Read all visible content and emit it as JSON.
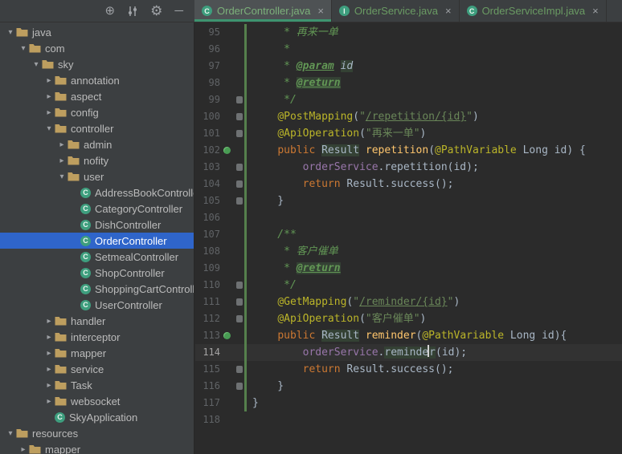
{
  "toolbar": {
    "icons": [
      {
        "name": "locate-icon",
        "glyph": "⊕"
      },
      {
        "name": "filter-sliders-icon",
        "glyph": "sliders"
      },
      {
        "name": "settings-gear-icon",
        "glyph": "⚙"
      },
      {
        "name": "hide-panel-icon",
        "glyph": "─"
      }
    ]
  },
  "tabs": [
    {
      "label": "OrderController.java",
      "icon_letter": "C",
      "close": "×",
      "active": true
    },
    {
      "label": "OrderService.java",
      "icon_letter": "I",
      "close": "×",
      "active": false
    },
    {
      "label": "OrderServiceImpl.java",
      "icon_letter": "C",
      "close": "×",
      "active": false
    }
  ],
  "colors": {
    "panel_bg": "#3C3F41",
    "editor_bg": "#2B2B2B",
    "selection_blue": "#2F65CA",
    "vcs_added_green": "#55804C",
    "tab_added_file_text": "#6A9B63",
    "active_tab_underline": "#3E946F",
    "identifier_highlight": "#344134",
    "folder": "#BD9E5F",
    "class_icon": "#3E9E7E"
  },
  "project_tree": {
    "items": [
      {
        "label": "java",
        "level": 0,
        "kind": "folder",
        "state": "open",
        "selected": false
      },
      {
        "label": "com",
        "level": 1,
        "kind": "folder",
        "state": "open",
        "selected": false
      },
      {
        "label": "sky",
        "level": 2,
        "kind": "folder",
        "state": "open",
        "selected": false
      },
      {
        "label": "annotation",
        "level": 3,
        "kind": "folder",
        "state": "closed",
        "selected": false
      },
      {
        "label": "aspect",
        "level": 3,
        "kind": "folder",
        "state": "closed",
        "selected": false
      },
      {
        "label": "config",
        "level": 3,
        "kind": "folder",
        "state": "closed",
        "selected": false
      },
      {
        "label": "controller",
        "level": 3,
        "kind": "folder",
        "state": "open",
        "selected": false
      },
      {
        "label": "admin",
        "level": 4,
        "kind": "folder",
        "state": "closed",
        "selected": false
      },
      {
        "label": "nofity",
        "level": 4,
        "kind": "folder",
        "state": "closed",
        "selected": false
      },
      {
        "label": "user",
        "level": 4,
        "kind": "folder",
        "state": "open",
        "selected": false
      },
      {
        "label": "AddressBookController",
        "level": 5,
        "kind": "class",
        "state": "leaf",
        "selected": false
      },
      {
        "label": "CategoryController",
        "level": 5,
        "kind": "class",
        "state": "leaf",
        "selected": false
      },
      {
        "label": "DishController",
        "level": 5,
        "kind": "class",
        "state": "leaf",
        "selected": false
      },
      {
        "label": "OrderController",
        "level": 5,
        "kind": "class",
        "state": "leaf",
        "selected": true
      },
      {
        "label": "SetmealController",
        "level": 5,
        "kind": "class",
        "state": "leaf",
        "selected": false
      },
      {
        "label": "ShopController",
        "level": 5,
        "kind": "class",
        "state": "leaf",
        "selected": false
      },
      {
        "label": "ShoppingCartController",
        "level": 5,
        "kind": "class",
        "state": "leaf",
        "selected": false
      },
      {
        "label": "UserController",
        "level": 5,
        "kind": "class",
        "state": "leaf",
        "selected": false
      },
      {
        "label": "handler",
        "level": 3,
        "kind": "folder",
        "state": "closed",
        "selected": false
      },
      {
        "label": "interceptor",
        "level": 3,
        "kind": "folder",
        "state": "closed",
        "selected": false
      },
      {
        "label": "mapper",
        "level": 3,
        "kind": "folder",
        "state": "closed",
        "selected": false
      },
      {
        "label": "service",
        "level": 3,
        "kind": "folder",
        "state": "closed",
        "selected": false
      },
      {
        "label": "Task",
        "level": 3,
        "kind": "folder",
        "state": "closed",
        "selected": false
      },
      {
        "label": "websocket",
        "level": 3,
        "kind": "folder",
        "state": "closed",
        "selected": false
      },
      {
        "label": "SkyApplication",
        "level": 3,
        "kind": "class",
        "state": "leaf",
        "selected": false
      },
      {
        "label": "resources",
        "level": 0,
        "kind": "folder",
        "state": "open",
        "selected": false
      },
      {
        "label": "mapper",
        "level": 1,
        "kind": "folder",
        "state": "closed",
        "selected": false
      }
    ]
  },
  "editor": {
    "current_line": 114,
    "lines": [
      {
        "n": 95,
        "mark": null,
        "seg": [
          [
            "c",
            "     * 再来一单"
          ]
        ]
      },
      {
        "n": 96,
        "mark": null,
        "seg": [
          [
            "c",
            "     *"
          ]
        ]
      },
      {
        "n": 97,
        "mark": null,
        "seg": [
          [
            "c",
            "     * "
          ],
          [
            "ct",
            "@param"
          ],
          [
            "c",
            " "
          ],
          [
            "cb",
            "id"
          ]
        ]
      },
      {
        "n": 98,
        "mark": null,
        "seg": [
          [
            "c",
            "     * "
          ],
          [
            "ctb",
            "@return"
          ]
        ]
      },
      {
        "n": 99,
        "mark": "gray",
        "seg": [
          [
            "c",
            "     */"
          ]
        ]
      },
      {
        "n": 100,
        "mark": "gray",
        "seg": [
          [
            "d",
            "    "
          ],
          [
            "a",
            "@PostMapping"
          ],
          [
            "d",
            "("
          ],
          [
            "s",
            "\""
          ],
          [
            "su",
            "/repetition/{id}"
          ],
          [
            "s",
            "\""
          ],
          [
            "d",
            ")"
          ]
        ]
      },
      {
        "n": 101,
        "mark": "gray",
        "seg": [
          [
            "d",
            "    "
          ],
          [
            "a",
            "@ApiOperation"
          ],
          [
            "d",
            "("
          ],
          [
            "s",
            "\"再来一单\""
          ],
          [
            "d",
            ")"
          ]
        ]
      },
      {
        "n": 102,
        "mark": "green",
        "seg": [
          [
            "d",
            "    "
          ],
          [
            "k",
            "public"
          ],
          [
            "d",
            " "
          ],
          [
            "box",
            "Result"
          ],
          [
            "d",
            " "
          ],
          [
            "m",
            "repetition"
          ],
          [
            "d",
            "("
          ],
          [
            "a",
            "@PathVariable"
          ],
          [
            "d",
            " Long id) {"
          ]
        ]
      },
      {
        "n": 103,
        "mark": "gray",
        "seg": [
          [
            "d",
            "        "
          ],
          [
            "f",
            "orderService"
          ],
          [
            "d",
            ".repetition(id);"
          ]
        ]
      },
      {
        "n": 104,
        "mark": "gray",
        "seg": [
          [
            "d",
            "        "
          ],
          [
            "k",
            "return"
          ],
          [
            "d",
            " Result.success();"
          ]
        ]
      },
      {
        "n": 105,
        "mark": "gray",
        "seg": [
          [
            "d",
            "    }"
          ]
        ]
      },
      {
        "n": 106,
        "mark": null,
        "seg": []
      },
      {
        "n": 107,
        "mark": null,
        "seg": [
          [
            "c",
            "    /**"
          ]
        ]
      },
      {
        "n": 108,
        "mark": null,
        "seg": [
          [
            "c",
            "     * 客户催单"
          ]
        ]
      },
      {
        "n": 109,
        "mark": null,
        "seg": [
          [
            "c",
            "     * "
          ],
          [
            "ctb",
            "@return"
          ]
        ]
      },
      {
        "n": 110,
        "mark": "gray",
        "seg": [
          [
            "c",
            "     */"
          ]
        ]
      },
      {
        "n": 111,
        "mark": "gray",
        "seg": [
          [
            "d",
            "    "
          ],
          [
            "a",
            "@GetMapping"
          ],
          [
            "d",
            "("
          ],
          [
            "s",
            "\""
          ],
          [
            "su",
            "/reminder/{id}"
          ],
          [
            "s",
            "\""
          ],
          [
            "d",
            ")"
          ]
        ]
      },
      {
        "n": 112,
        "mark": "gray",
        "seg": [
          [
            "d",
            "    "
          ],
          [
            "a",
            "@ApiOperation"
          ],
          [
            "d",
            "("
          ],
          [
            "s",
            "\"客户催单\""
          ],
          [
            "d",
            ")"
          ]
        ]
      },
      {
        "n": 113,
        "mark": "green",
        "seg": [
          [
            "d",
            "    "
          ],
          [
            "k",
            "public"
          ],
          [
            "d",
            " "
          ],
          [
            "box",
            "Result"
          ],
          [
            "d",
            " "
          ],
          [
            "m",
            "reminder"
          ],
          [
            "d",
            "("
          ],
          [
            "a",
            "@PathVariable"
          ],
          [
            "d",
            " Long id){"
          ]
        ]
      },
      {
        "n": 114,
        "mark": null,
        "seg": [
          [
            "d",
            "        "
          ],
          [
            "f",
            "orderService"
          ],
          [
            "d",
            "."
          ],
          [
            "box",
            "reminde"
          ],
          [
            "caret",
            ""
          ],
          [
            "box",
            "r"
          ],
          [
            "d",
            "(id);"
          ]
        ]
      },
      {
        "n": 115,
        "mark": "gray",
        "seg": [
          [
            "d",
            "        "
          ],
          [
            "k",
            "return"
          ],
          [
            "d",
            " Result.success();"
          ]
        ]
      },
      {
        "n": 116,
        "mark": "gray",
        "seg": [
          [
            "d",
            "    }"
          ]
        ]
      },
      {
        "n": 117,
        "mark": null,
        "seg": [
          [
            "d",
            "}"
          ]
        ]
      },
      {
        "n": 118,
        "mark": null,
        "seg": []
      }
    ]
  }
}
